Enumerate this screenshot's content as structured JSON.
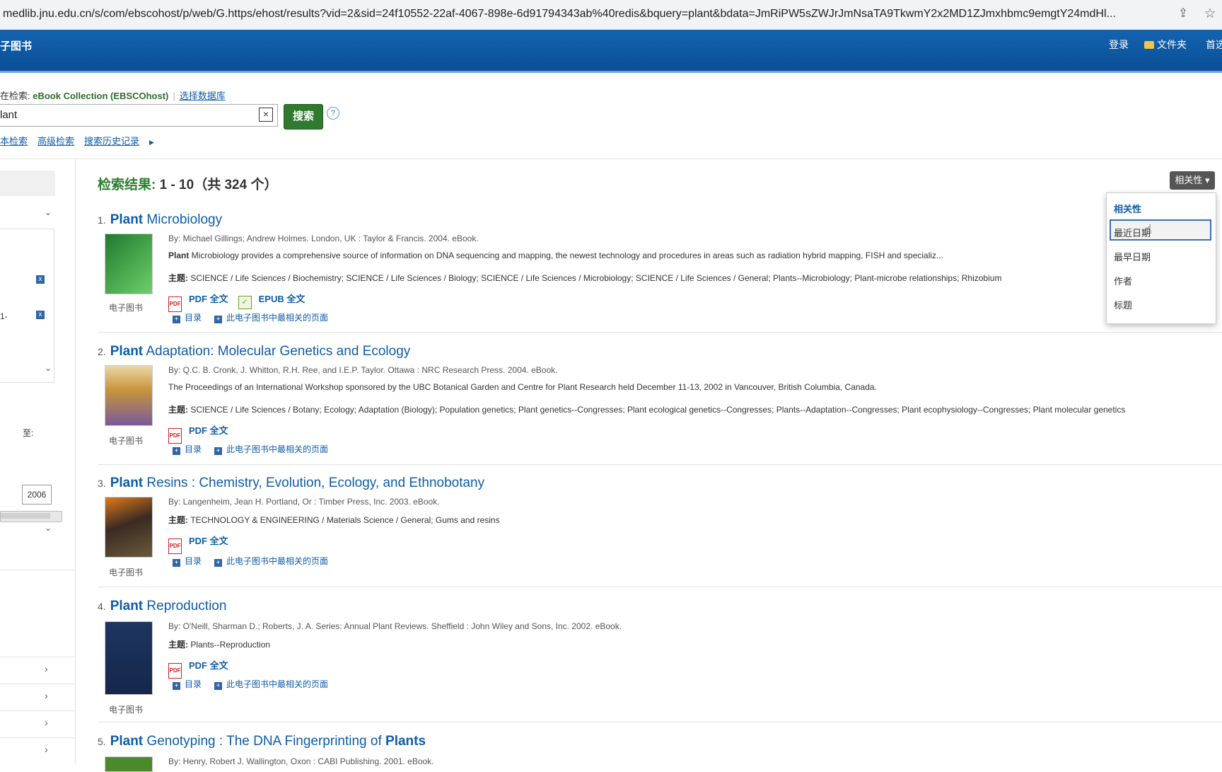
{
  "browser": {
    "url": "medlib.jnu.edu.cn/s/com/ebscohost/p/web/G.https/ehost/results?vid=2&sid=24f10552-22af-4067-898e-6d91794343ab%40redis&bquery=plant&bdata=JmRiPW5sZWJrJmNsaTA9TkwmY2x2MD1ZJmxhbmc9emgtY24mdHl..."
  },
  "header": {
    "brand": "子图书",
    "login": "登录",
    "folder": "文件夹",
    "prefs": "首选"
  },
  "search": {
    "searching_label": "在检索: ",
    "database": "eBook Collection (EBSCOhost)",
    "choose_db": "选择数据库",
    "query": "lant",
    "clear": "×",
    "button": "搜索",
    "help": "?",
    "links": [
      "本检索",
      "高级检索",
      "搜索历史记录"
    ]
  },
  "sidebar": {
    "text1": "1-",
    "to_label": "至:",
    "year_to": "2006"
  },
  "results_header": {
    "label": "检索结果:",
    "range": " 1 - 10（共 324 个）"
  },
  "sort": {
    "button": "相关性 ▾",
    "options": [
      "相关性",
      "最近日期",
      "最早日期",
      "作者",
      "标题"
    ]
  },
  "common": {
    "pdf": "PDF 全文",
    "epub": "EPUB 全文",
    "toc": "目录",
    "relevant_pages": "此电子图书中最相关的页面",
    "ebook": "电子图书",
    "subject_label": "主题:"
  },
  "results": [
    {
      "num": "1.",
      "title_bold": "Plant",
      "title_rest": " Microbiology",
      "by": "By: Michael Gillings; Andrew Holmes. London, UK : Taylor & Francis. 2004. eBook.",
      "abstract_bold": "Plant",
      "abstract": " Microbiology provides a comprehensive source of information on DNA sequencing and mapping, the newest technology and procedures in areas such as radiation hybrid mapping, FISH and specializ...",
      "subjects": " SCIENCE / Life Sciences / Biochemistry; SCIENCE / Life Sciences / Biology; SCIENCE / Life Sciences / Microbiology; SCIENCE / Life Sciences / General; Plants--Microbiology; Plant-microbe relationships; Rhizobium",
      "cover_color": "#2f8f3a"
    },
    {
      "num": "2.",
      "title_bold": "Plant",
      "title_rest": " Adaptation: Molecular Genetics and Ecology",
      "by": "By: Q.C. B. Cronk, J. Whitton, R.H. Ree, and I.E.P. Taylor. Ottawa : NRC Research Press. 2004. eBook.",
      "abstract": "The Proceedings of an International Workshop sponsored by the UBC Botanical Garden and Centre for Plant Research held December 11-13, 2002 in Vancouver, British Columbia, Canada.",
      "subjects": " SCIENCE / Life Sciences / Botany; Ecology; Adaptation (Biology); Population genetics; Plant genetics--Congresses; Plant ecological genetics--Congresses; Plants--Adaptation--Congresses; Plant ecophysiology--Congresses; Plant molecular genetics",
      "cover_color": "#c8953a"
    },
    {
      "num": "3.",
      "title_bold": "Plant",
      "title_rest": " Resins : Chemistry, Evolution, Ecology, and Ethnobotany",
      "by": "By: Langenheim, Jean H. Portland, Or : Timber Press, Inc. 2003. eBook.",
      "subjects": " TECHNOLOGY & ENGINEERING / Materials Science / General; Gums and resins",
      "cover_color": "#3a2a22"
    },
    {
      "num": "4.",
      "title_bold": "Plant",
      "title_rest": " Reproduction",
      "by": "By: O'Neill, Sharman D.; Roberts, J. A. Series: Annual Plant Reviews. Sheffield : John Wiley and Sons, Inc. 2002. eBook.",
      "subjects": " Plants--Reproduction",
      "cover_color": "#15274a"
    },
    {
      "num": "5.",
      "title_bold": "Plant",
      "title_rest": " Genotyping : The DNA Fingerprinting of ",
      "title_bold2": "Plants",
      "by": "By: Henry, Robert J. Wallington, Oxon : CABI Publishing. 2001. eBook."
    }
  ]
}
